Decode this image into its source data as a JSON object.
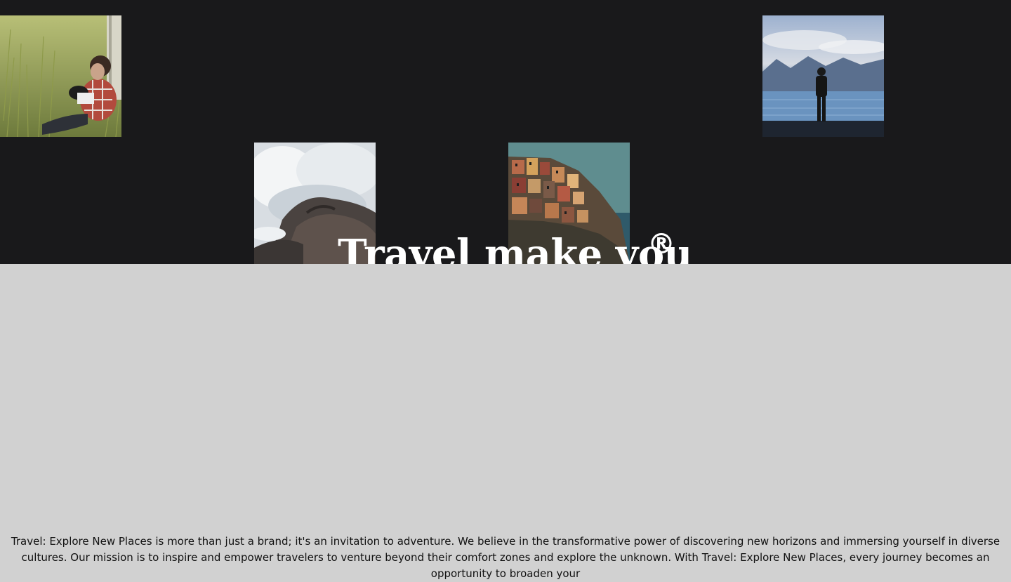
{
  "hero": {
    "title": "Travel make you",
    "mark": "®",
    "background": "#19191b",
    "photos": [
      {
        "name": "man-reading-in-grass-photo",
        "subject": "man reading a book in tall grass with a dog"
      },
      {
        "name": "person-at-lake-photo",
        "subject": "person standing by a lake with mountains"
      },
      {
        "name": "waves-on-rocks-photo",
        "subject": "waves crashing on rocks"
      },
      {
        "name": "cliffside-village-photo",
        "subject": "colorful cliffside village"
      }
    ]
  },
  "about": {
    "text": "Travel: Explore New Places is more than just a brand; it's an invitation to adventure. We believe in the transformative power of discovering new horizons and immersing yourself in diverse cultures. Our mission is to inspire and empower travelers to venture beyond their comfort zones and explore the unknown. With Travel: Explore New Places, every journey becomes an opportunity to broaden your"
  },
  "colors": {
    "page_background": "#d1d1d1",
    "hero_background": "#19191b",
    "title_color": "#ffffff",
    "body_text": "#111111"
  }
}
